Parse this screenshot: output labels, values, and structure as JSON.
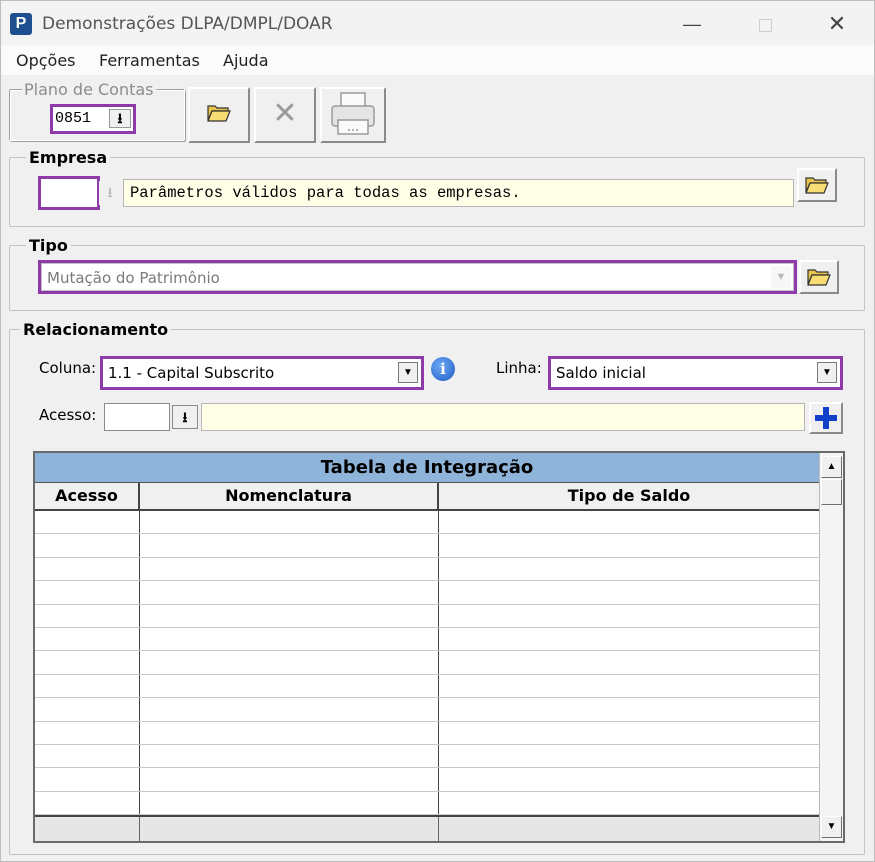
{
  "window": {
    "app_icon_letter": "P",
    "title": "Demonstrações DLPA/DMPL/DOAR",
    "minimize_glyph": "—",
    "close_glyph": "✕"
  },
  "menu": {
    "items": [
      "Opções",
      "Ferramentas",
      "Ajuda"
    ]
  },
  "plano": {
    "title": "Plano de Contas",
    "value": "0851",
    "dropdown_glyph": "⭳"
  },
  "toolbar": {
    "cancel_glyph": "✕"
  },
  "empresa": {
    "title": "Empresa",
    "code": "",
    "dropdown_glyph": "⭳",
    "description": "Parâmetros válidos para todas as empresas."
  },
  "tipo": {
    "title": "Tipo",
    "value": "Mutação do Patrimônio",
    "dropdown_glyph": "▼"
  },
  "relacionamento": {
    "title": "Relacionamento",
    "coluna_label": "Coluna:",
    "coluna_value": "1.1 - Capital Subscrito",
    "info_glyph": "i",
    "linha_label": "Linha:",
    "linha_value": "Saldo inicial",
    "acesso_label": "Acesso:",
    "acesso_code": "",
    "acesso_dropdown_glyph": "⭳",
    "acesso_description": "",
    "combo_arrow_glyph": "▼"
  },
  "grid": {
    "title": "Tabela de Integração",
    "columns": [
      "Acesso",
      "Nomenclatura",
      "Tipo de Saldo"
    ],
    "scroll_up_glyph": "▲",
    "scroll_down_glyph": "▼"
  },
  "icons": {
    "open_folder": "folder-open-icon",
    "cancel": "close-icon",
    "print": "printer-icon",
    "add": "plus-icon",
    "info": "info-icon"
  },
  "colors": {
    "highlight": "#8e3aa8",
    "grid_title_bg": "#8fb4d9",
    "input_yellow": "#ffffe8",
    "plus_blue": "#1240c8"
  }
}
